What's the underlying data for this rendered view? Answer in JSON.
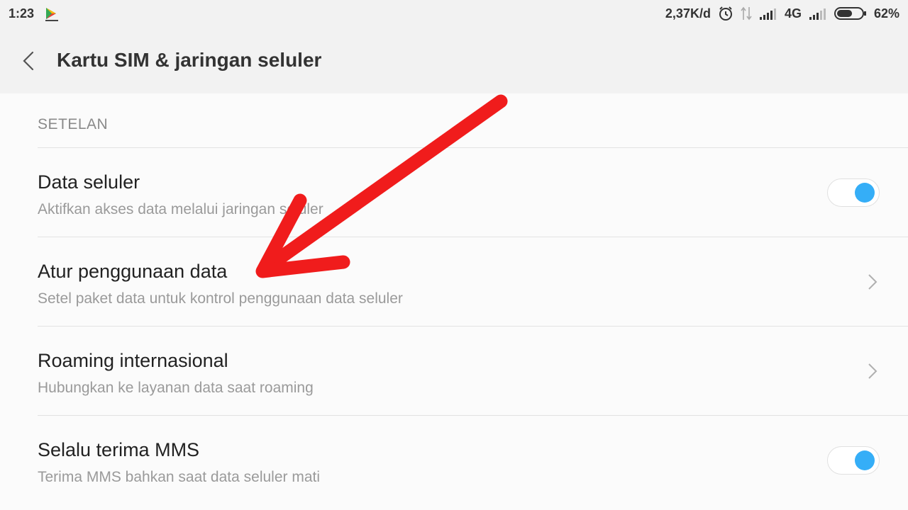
{
  "status_bar": {
    "time": "1:23",
    "net_speed": "2,37K/d",
    "network_type": "4G",
    "battery_percent": "62%",
    "battery_level": 0.62,
    "icons": [
      "play-store-icon",
      "alarm-clock-icon",
      "data-arrows-icon",
      "signal-icon",
      "battery-icon"
    ]
  },
  "header": {
    "back_icon": "chevron-left-icon",
    "title": "Kartu SIM & jaringan seluler"
  },
  "settings": {
    "section_label": "SETELAN",
    "items": [
      {
        "title": "Data seluler",
        "subtitle": "Aktifkan akses data melalui jaringan seluler",
        "control": "toggle",
        "on": true
      },
      {
        "title": "Atur penggunaan data",
        "subtitle": "Setel paket data untuk kontrol penggunaan data seluler",
        "control": "chevron"
      },
      {
        "title": "Roaming internasional",
        "subtitle": "Hubungkan ke layanan data saat roaming",
        "control": "chevron"
      },
      {
        "title": "Selalu terima MMS",
        "subtitle": "Terima MMS bahkan saat data seluler mati",
        "control": "toggle",
        "on": true
      }
    ]
  },
  "colors": {
    "accent": "#35aef7",
    "annotation_arrow": "#f01c1c"
  }
}
